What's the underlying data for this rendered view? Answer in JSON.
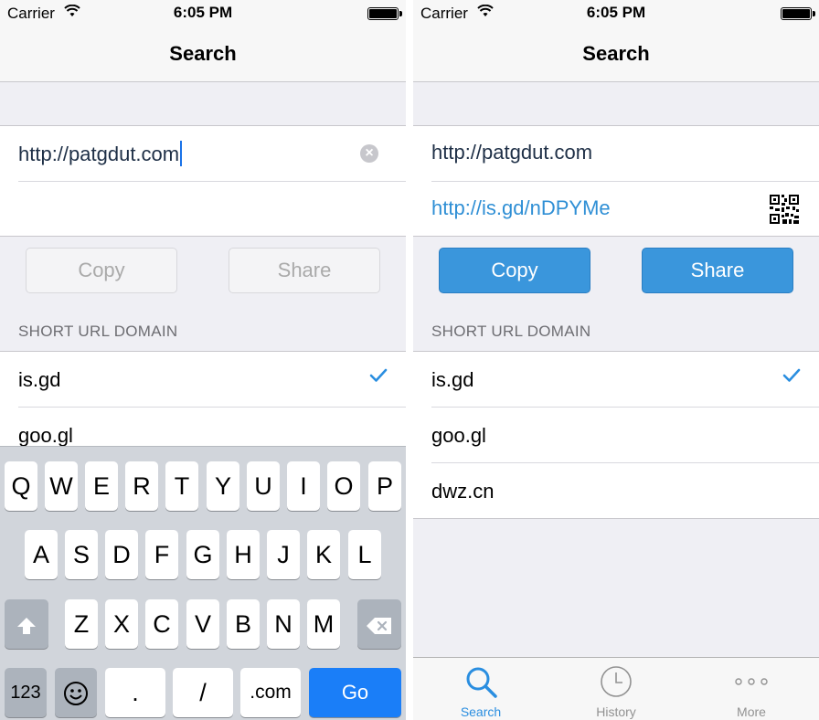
{
  "status": {
    "carrier": "Carrier",
    "time": "6:05 PM"
  },
  "nav": {
    "title": "Search"
  },
  "left": {
    "url_value": "http://patgdut.com",
    "copy_label": "Copy",
    "share_label": "Share",
    "section_header": "SHORT URL DOMAIN",
    "domains": [
      "is.gd",
      "goo.gl"
    ],
    "keyboard": {
      "row1": [
        "Q",
        "W",
        "E",
        "R",
        "T",
        "Y",
        "U",
        "I",
        "O",
        "P"
      ],
      "row2": [
        "A",
        "S",
        "D",
        "F",
        "G",
        "H",
        "J",
        "K",
        "L"
      ],
      "row3": [
        "Z",
        "X",
        "C",
        "V",
        "B",
        "N",
        "M"
      ],
      "numbers_label": "123",
      "dot_label": ".",
      "slash_label": "/",
      "dotcom_label": ".com",
      "go_label": "Go"
    }
  },
  "right": {
    "url_value": "http://patgdut.com",
    "short_url": "http://is.gd/nDPYMe",
    "copy_label": "Copy",
    "share_label": "Share",
    "section_header": "SHORT URL DOMAIN",
    "domains": [
      "is.gd",
      "goo.gl",
      "dwz.cn"
    ],
    "tabs": [
      {
        "label": "Search",
        "icon": "search-icon"
      },
      {
        "label": "History",
        "icon": "clock-icon"
      },
      {
        "label": "More",
        "icon": "more-icon"
      }
    ]
  },
  "colors": {
    "accent": "#2a8ee0",
    "button_active": "#3a96dc",
    "go_key": "#1a7ef8"
  }
}
